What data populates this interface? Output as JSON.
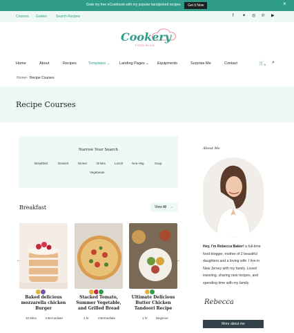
{
  "announcement": {
    "message": "Grab my free eCookbook with my popular handpicked recipes",
    "cta": "Get it Now"
  },
  "topbar": {
    "links": [
      "Courses",
      "Guides",
      "Search Recipes"
    ]
  },
  "logo": {
    "wordmark": "Cookery",
    "tagline": "FOOD BLOG"
  },
  "nav": {
    "items": [
      "Home",
      "About",
      "Recipes",
      "Templates",
      "Landing Pages",
      "Equipments",
      "Surprise Me",
      "Contact"
    ],
    "cart_count": "0"
  },
  "breadcrumb": {
    "home": "Home",
    "sep": ">",
    "current": "Recipe Courses"
  },
  "hero": {
    "title": "Recipe Courses"
  },
  "filter": {
    "title": "Narrow Your Search",
    "tags": [
      "Breakfast",
      "Dessert",
      "Dinner",
      "Drinks",
      "Lunch",
      "Non-Veg",
      "Soup",
      "Vegetarian"
    ]
  },
  "section": {
    "title": "Breakfast",
    "view_all": "View All"
  },
  "cards": [
    {
      "title_lines": [
        "Baked delicious",
        "mozzarella chicken",
        "Burger"
      ],
      "meta_time": "30 Mins",
      "meta_level": "Intermediate"
    },
    {
      "title_lines": [
        "Stacked Tomato,",
        "Summer Vegetable,",
        "and Grilled Bread"
      ],
      "meta_time": "1 hr",
      "meta_level": "Intermediate"
    },
    {
      "title_lines": [
        "Ultimate Delicious",
        "Butter Chicken",
        "Tandoori Recipe"
      ],
      "meta_time": "1 hr",
      "meta_level": "Beginner"
    }
  ],
  "about": {
    "heading": "About Me",
    "bio_name": "Hey, I'm Rebecca Baker!",
    "bio_text": " a full-time food blogger, mother of 2 beautiful daughters and a loving wife. I live in New Jersey with my family. Loved traveling, sharing new recipes, and spending time with my family.",
    "signature": "Rebecca",
    "button": "More about me"
  },
  "colors": {
    "accent": "#2f9c8a",
    "mint_bg": "#eef8f5",
    "dark_button": "#32404a",
    "pink": "#e26a7c"
  }
}
